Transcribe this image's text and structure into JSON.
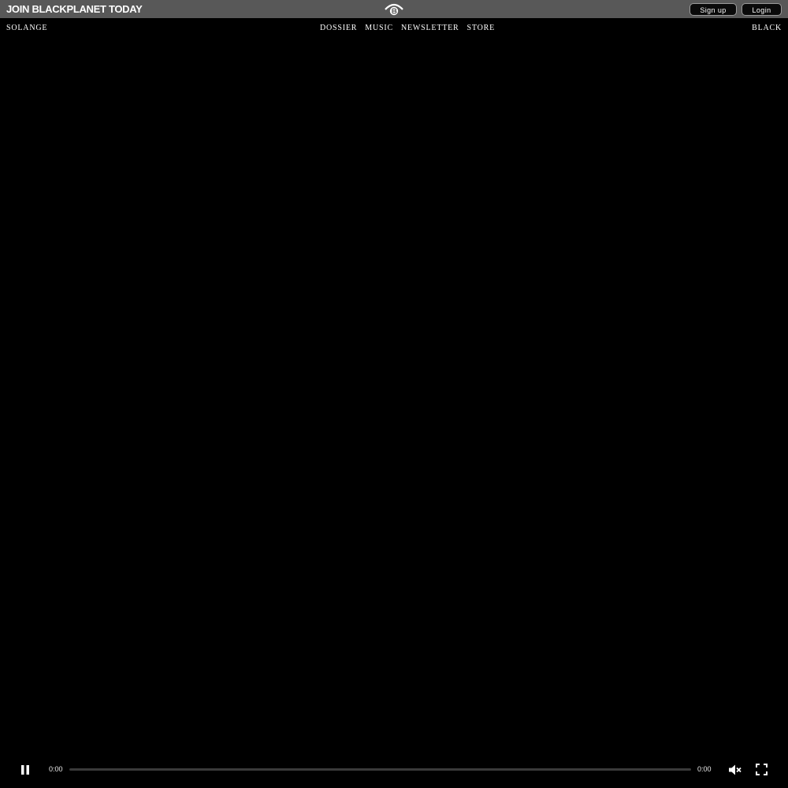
{
  "topbar": {
    "join_text": "JOIN BLACKPLANET TODAY",
    "logo_icon": "blackplanet-logo-icon",
    "signup_label": "Sign up",
    "login_label": "Login"
  },
  "nav": {
    "left": "SOLANGE",
    "links": [
      "DOSSIER",
      "MUSIC",
      "NEWSLETTER",
      "STORE"
    ],
    "right": "BLACK"
  },
  "player": {
    "current_time": "0:00",
    "duration": "0:00",
    "progress": 0,
    "play_state_icon": "pause-icon",
    "volume_icon": "mute-icon",
    "fullscreen_icon": "fullscreen-icon"
  },
  "colors": {
    "topbar_bg": "#585858",
    "page_bg": "#000000"
  }
}
